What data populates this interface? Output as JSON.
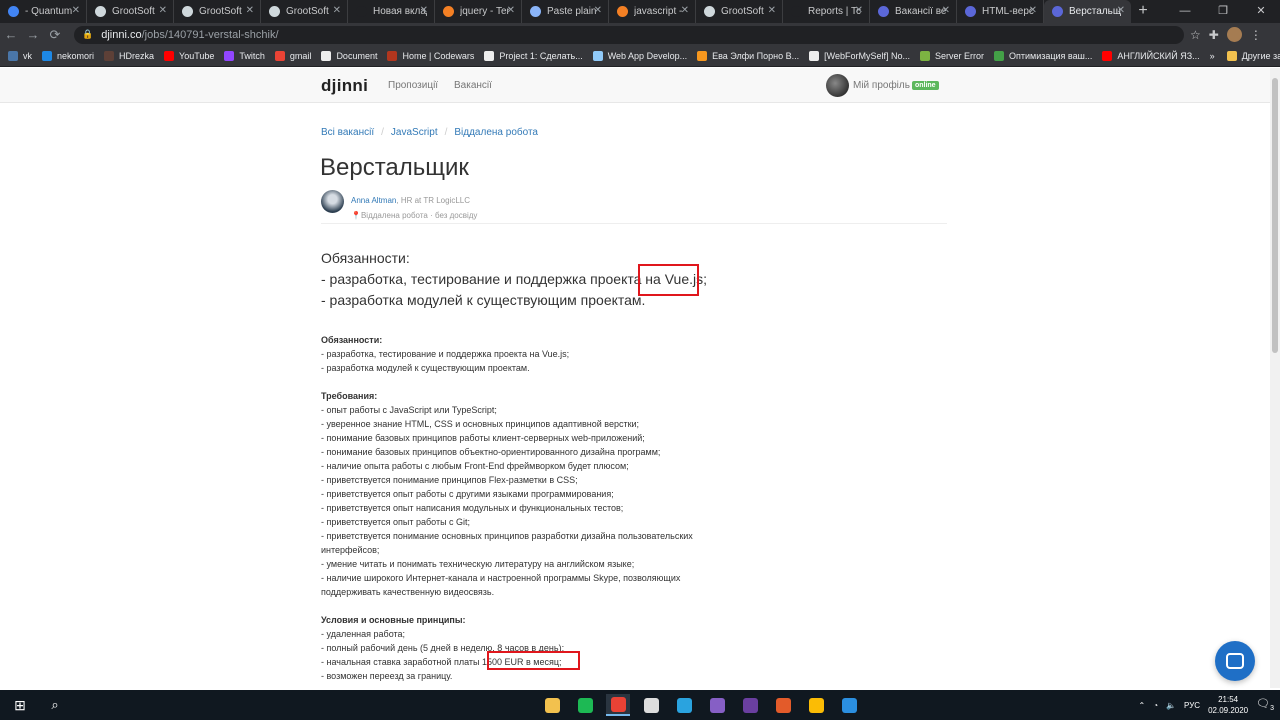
{
  "browser": {
    "tabs": [
      {
        "title": "- Quantum",
        "color": "#4285f4",
        "active": false
      },
      {
        "title": "GrootSoft",
        "color": "#cfd8dc",
        "active": false
      },
      {
        "title": "GrootSoft",
        "color": "#cfd8dc",
        "active": false
      },
      {
        "title": "GrootSoft",
        "color": "#cfd8dc",
        "active": false
      },
      {
        "title": "Новая вкладка",
        "color": "#202124",
        "active": false
      },
      {
        "title": "jquery - Ter",
        "color": "#f48024",
        "active": false
      },
      {
        "title": "Paste plain",
        "color": "#8ab4f8",
        "active": false
      },
      {
        "title": "javascript -",
        "color": "#f48024",
        "active": false
      },
      {
        "title": "GrootSoft",
        "color": "#cfd8dc",
        "active": false
      },
      {
        "title": "Reports | Tc",
        "color": "#202124",
        "active": false
      },
      {
        "title": "Вакансії ве",
        "color": "#5b67d8",
        "active": false
      },
      {
        "title": "HTML-верс",
        "color": "#5b67d8",
        "active": false
      },
      {
        "title": "Верстальщ",
        "color": "#5b67d8",
        "active": true
      }
    ],
    "new_tab": "+",
    "window_buttons": [
      "—",
      "❐",
      "✕"
    ],
    "url_host": "djinni.co",
    "url_path": "/jobs/140791-verstal-shchik/",
    "bookmarks": [
      {
        "label": "vk",
        "color": "#4a76a8"
      },
      {
        "label": "nekomori",
        "color": "#1e88e5"
      },
      {
        "label": "HDrezka",
        "color": "#5d4037"
      },
      {
        "label": "YouTube",
        "color": "#ff0000"
      },
      {
        "label": "Twitch",
        "color": "#9146ff"
      },
      {
        "label": "gmail",
        "color": "#ea4335"
      },
      {
        "label": "Document",
        "color": "#eeeeee"
      },
      {
        "label": "Home | Codewars",
        "color": "#b1361e"
      },
      {
        "label": "Project 1: Сделать...",
        "color": "#eeeeee"
      },
      {
        "label": "Web App Develop...",
        "color": "#90caf9"
      },
      {
        "label": "Ева Элфи Порно В...",
        "color": "#f7971e"
      },
      {
        "label": "[WebForMySelf] No...",
        "color": "#eeeeee"
      },
      {
        "label": "Server Error",
        "color": "#7cb342"
      },
      {
        "label": "Оптимизация ваш...",
        "color": "#43a047"
      },
      {
        "label": "АНГЛИЙСКИЙ ЯЗ...",
        "color": "#ff0000"
      }
    ],
    "bookmarks_more": "»",
    "other_bookmarks": "Другие закладки"
  },
  "site": {
    "logo": "djinni",
    "nav": [
      "Пропозиції",
      "Вакансії"
    ],
    "profile_label": "Мій профіль",
    "online_badge": "online"
  },
  "breadcrumbs": [
    "Всі вакансії",
    "JavaScript",
    "Віддалена робота"
  ],
  "job": {
    "title": "Верстальщик",
    "author_name": "Anna Altman",
    "author_role": ", HR at TR LogicLLC",
    "author_meta": "Віддалена робота · без досвіду",
    "lead": [
      "Обязанности:",
      "- разработка, тестирование и поддержка проекта на Vue.js;",
      "- разработка модулей к существующим проектам."
    ],
    "sections": [
      {
        "heading": "Обязанности:",
        "lines": [
          "- разработка, тестирование и поддержка проекта на Vue.js;",
          "- разработка модулей к существующим проектам."
        ]
      },
      {
        "heading": "Требования:",
        "lines": [
          "- опыт работы с JavaScript или TypeScript;",
          "- уверенное знание HTML, CSS и основных принципов адаптивной верстки;",
          "- понимание базовых принципов работы клиент-серверных web-приложений;",
          "- понимание базовых принципов объектно-ориентированного дизайна программ;",
          "- наличие опыта работы с любым Front-End фреймворком будет плюсом;",
          "- приветствуется понимание принципов Flex-разметки в CSS;",
          "- приветствуется опыт работы с другими языками программирования;",
          "- приветствуется опыт написания модульных и функциональных тестов;",
          "- приветствуется опыт работы с Git;",
          "- приветствуется понимание основных принципов разработки дизайна пользовательских интерфейсов;",
          "- умение читать и понимать техническую литературу на английском языке;",
          "- наличие широкого Интернет-канала и настроенной программы Skype, позволяющих поддерживать качественную видеосвязь."
        ]
      },
      {
        "heading": "Условия и основные принципы:",
        "lines": [
          "- удаленная работа;",
          "- полный рабочий день (5 дней в неделю, 8 часов в день);",
          "- начальная ставка заработной платы 1500 EUR в месяц;",
          "- возможен переезд за границу."
        ]
      }
    ]
  },
  "taskbar": {
    "apps": [
      {
        "name": "file-explorer",
        "color": "#f2c14e",
        "active": false
      },
      {
        "name": "spotify",
        "color": "#1db954",
        "active": false
      },
      {
        "name": "chrome",
        "color": "#e94235",
        "active": true
      },
      {
        "name": "app-circle",
        "color": "#dddddd",
        "active": false
      },
      {
        "name": "telegram",
        "color": "#2aa3df",
        "active": false
      },
      {
        "name": "visual-studio",
        "color": "#865fc5",
        "active": false
      },
      {
        "name": "app-purple",
        "color": "#6a3fa0",
        "active": false
      },
      {
        "name": "nr-app",
        "color": "#e35b2a",
        "active": false
      },
      {
        "name": "chrome-2",
        "color": "#fbbc05",
        "active": false
      },
      {
        "name": "vscode",
        "color": "#2b8fe0",
        "active": false
      }
    ],
    "language": "РУС",
    "time": "21:54",
    "date": "02.09.2020",
    "notifications": "3"
  }
}
